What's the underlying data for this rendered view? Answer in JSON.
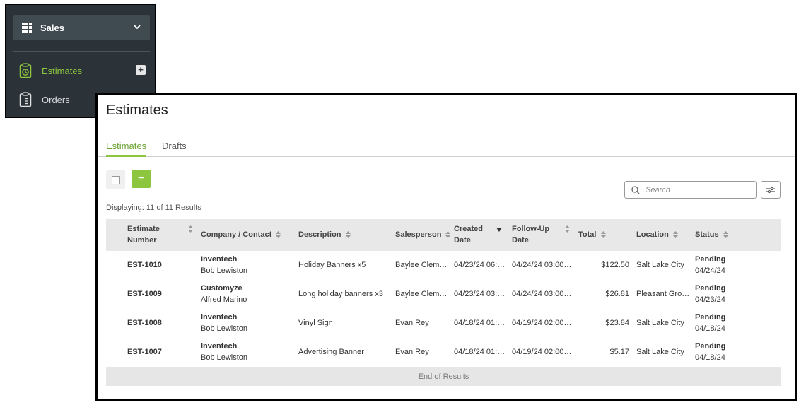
{
  "sidebar": {
    "module_label": "Sales",
    "items": [
      {
        "label": "Estimates",
        "active": true
      },
      {
        "label": "Orders",
        "active": false
      }
    ],
    "accent_color": "#8cc63f"
  },
  "page": {
    "title": "Estimates",
    "tabs": [
      {
        "label": "Estimates",
        "active": true
      },
      {
        "label": "Drafts",
        "active": false
      }
    ],
    "add_label": "+",
    "search_placeholder": "Search",
    "displaying_label": "Displaying:",
    "displaying_count": "11 of 11 Results",
    "end_of_results": "End of Results"
  },
  "table": {
    "columns": [
      {
        "line1": "Estimate",
        "line2": "Number"
      },
      {
        "line1": "Company / Contact"
      },
      {
        "line1": "Description"
      },
      {
        "line1": "Salesperson"
      },
      {
        "line1": "Created",
        "line2": "Date"
      },
      {
        "line1": "Follow-Up",
        "line2": "Date"
      },
      {
        "line1": "Total"
      },
      {
        "line1": "Location"
      },
      {
        "line1": "Status"
      }
    ],
    "rows": [
      {
        "number": "EST-1010",
        "company": "Inventech",
        "contact": "Bob Lewiston",
        "description": "Holiday Banners x5",
        "salesperson": "Baylee Clem…",
        "created": "04/23/24 06:…",
        "followup": "04/24/24 03:00…",
        "total": "$122.50",
        "location": "Salt Lake City",
        "status": "Pending",
        "status_date": "04/24/24"
      },
      {
        "number": "EST-1009",
        "company": "Customyze",
        "contact": "Alfred Marino",
        "description": "Long holiday banners x3",
        "salesperson": "Baylee Clem…",
        "created": "04/23/24 03:…",
        "followup": "04/24/24 03:00…",
        "total": "$26.81",
        "location": "Pleasant Gro…",
        "status": "Pending",
        "status_date": "04/23/24"
      },
      {
        "number": "EST-1008",
        "company": "Inventech",
        "contact": "Bob Lewiston",
        "description": "Vinyl Sign",
        "salesperson": "Evan Rey",
        "created": "04/18/24 01:…",
        "followup": "04/19/24 02:00…",
        "total": "$23.84",
        "location": "Salt Lake City",
        "status": "Pending",
        "status_date": "04/18/24"
      },
      {
        "number": "EST-1007",
        "company": "Inventech",
        "contact": "Bob Lewiston",
        "description": "Advertising Banner",
        "salesperson": "Evan Rey",
        "created": "04/18/24 01:…",
        "followup": "04/19/24 02:00…",
        "total": "$5.17",
        "location": "Salt Lake City",
        "status": "Pending",
        "status_date": "04/18/24"
      }
    ]
  }
}
